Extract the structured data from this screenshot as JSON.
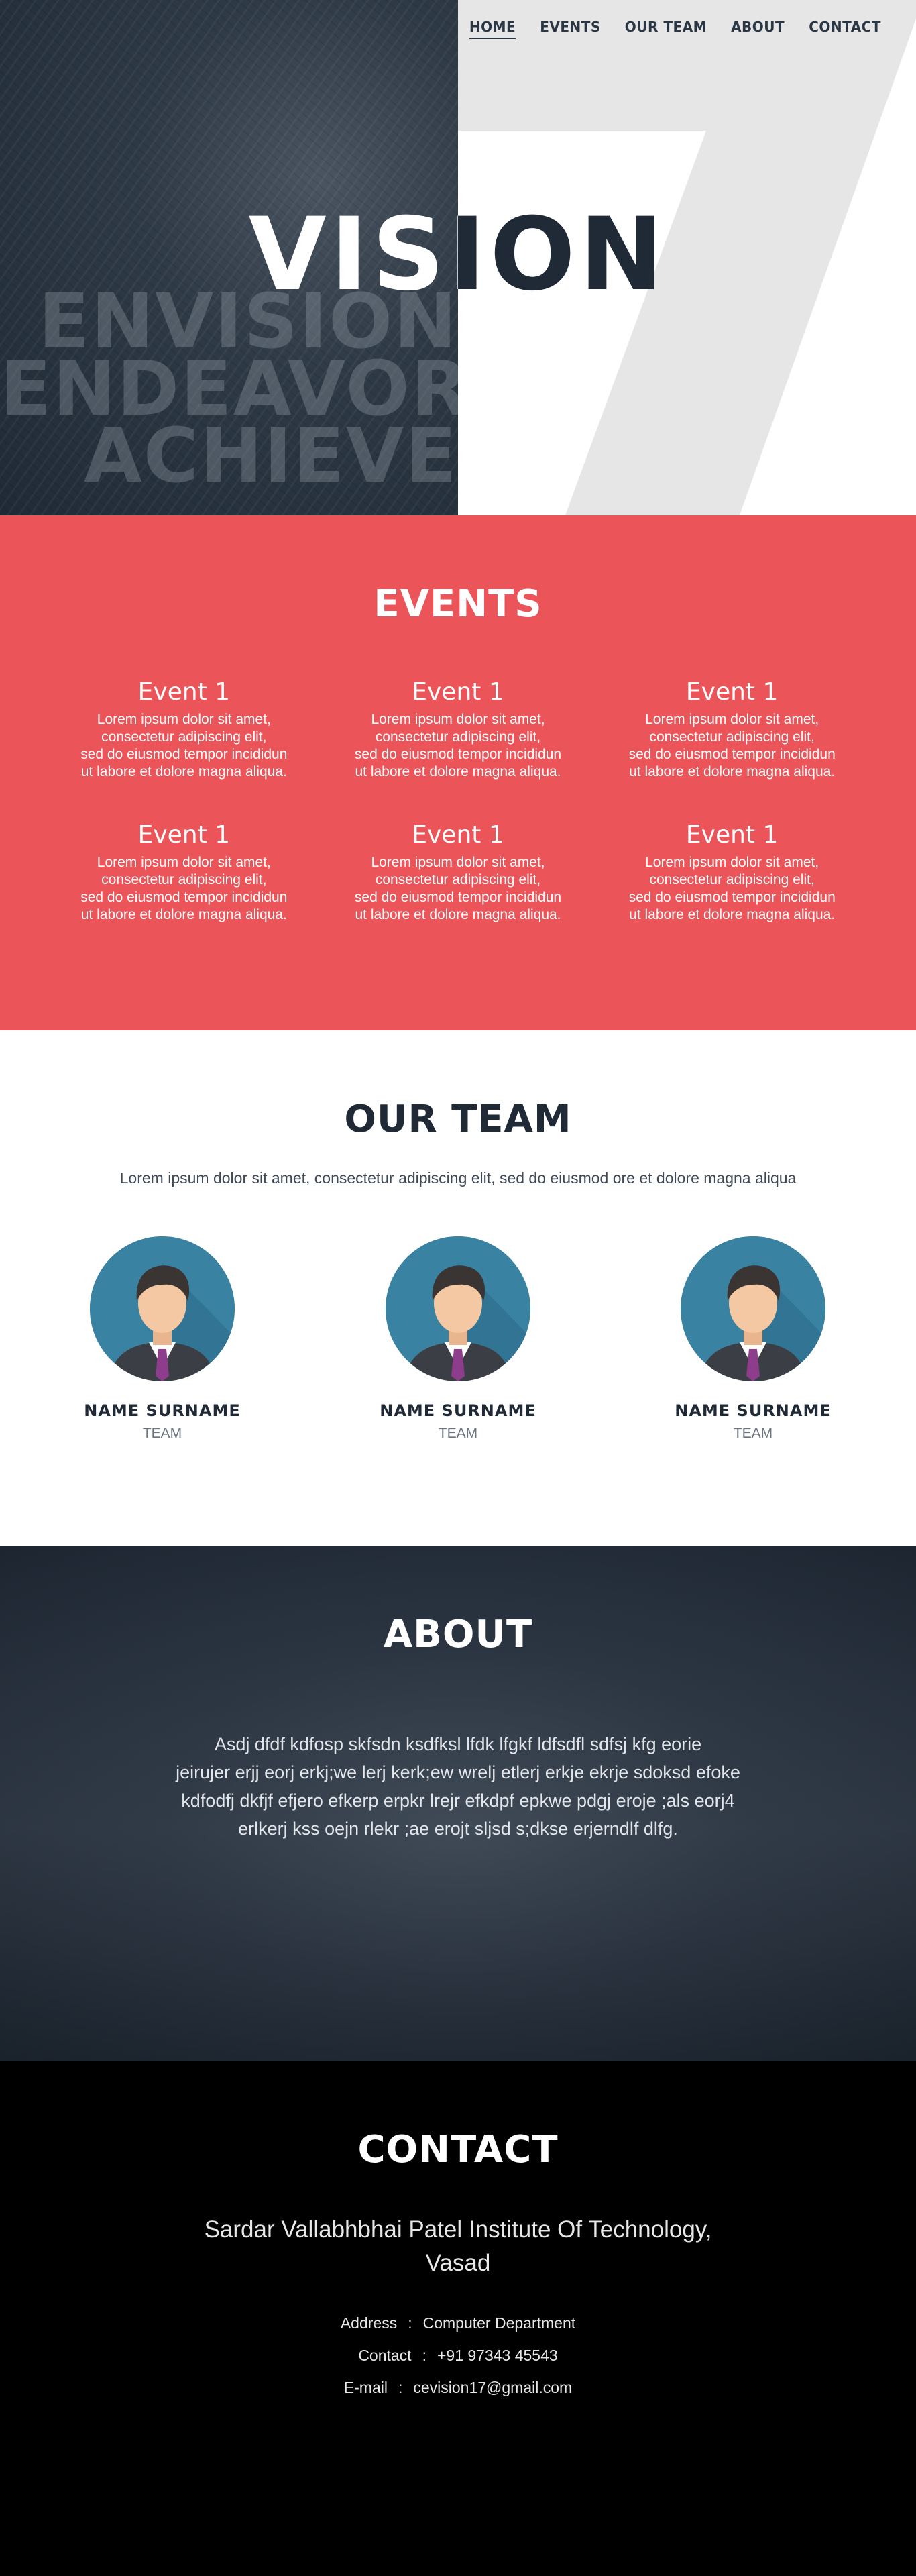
{
  "nav": {
    "items": [
      {
        "label": "HOME",
        "active": true
      },
      {
        "label": "EVENTS",
        "active": false
      },
      {
        "label": "OUR TEAM",
        "active": false
      },
      {
        "label": "ABOUT",
        "active": false
      },
      {
        "label": "CONTACT",
        "active": false
      }
    ]
  },
  "hero": {
    "title": "VISION",
    "words": [
      "ENVISION",
      "ENDEAVOR",
      "ACHIEVE"
    ],
    "big_numeral": "7"
  },
  "events": {
    "title": "EVENTS",
    "items": [
      {
        "title": "Event 1",
        "lines": [
          "Lorem ipsum dolor sit amet,",
          "consectetur adipiscing elit,",
          "sed do eiusmod tempor incididun",
          "ut labore et dolore magna aliqua."
        ]
      },
      {
        "title": "Event 1",
        "lines": [
          "Lorem ipsum dolor sit amet,",
          "consectetur adipiscing elit,",
          "sed do eiusmod tempor incididun",
          "ut labore et dolore magna aliqua."
        ]
      },
      {
        "title": "Event 1",
        "lines": [
          "Lorem ipsum dolor sit amet,",
          "consectetur adipiscing elit,",
          "sed do eiusmod tempor incididun",
          "ut labore et dolore magna aliqua."
        ]
      },
      {
        "title": "Event 1",
        "lines": [
          "Lorem ipsum dolor sit amet,",
          "consectetur adipiscing elit,",
          "sed do eiusmod tempor incididun",
          "ut labore et dolore magna aliqua."
        ]
      },
      {
        "title": "Event 1",
        "lines": [
          "Lorem ipsum dolor sit amet,",
          "consectetur adipiscing elit,",
          "sed do eiusmod tempor incididun",
          "ut labore et dolore magna aliqua."
        ]
      },
      {
        "title": "Event 1",
        "lines": [
          "Lorem ipsum dolor sit amet,",
          "consectetur adipiscing elit,",
          "sed do eiusmod tempor incididun",
          "ut labore et dolore magna aliqua."
        ]
      }
    ]
  },
  "team": {
    "title": "OUR TEAM",
    "intro": "Lorem ipsum dolor sit amet, consectetur adipiscing elit, sed do eiusmod ore et dolore magna aliqua",
    "members": [
      {
        "name": "NAME SURNAME",
        "role": "TEAM"
      },
      {
        "name": "NAME SURNAME",
        "role": "TEAM"
      },
      {
        "name": "NAME SURNAME",
        "role": "TEAM"
      }
    ]
  },
  "about": {
    "title": "ABOUT",
    "lines": [
      "Asdj dfdf kdfosp skfsdn ksdfksl lfdk lfgkf ldfsdfl sdfsj kfg eorie",
      "jeirujer erjj eorj erkj;we lerj kerk;ew wrelj etlerj erkje ekrje  sdoksd efoke",
      "kdfodfj dkfjf efjero efkerp erpkr lrejr efkdpf epkwe pdgj eroje ;als eorj4",
      "erlkerj kss oejn rlekr ;ae erojt sljsd s;dkse erjerndlf dlfg."
    ]
  },
  "contact": {
    "title": "CONTACT",
    "institute_lines": [
      "Sardar Vallabhbhai Patel Institute Of Technology,",
      "Vasad"
    ],
    "rows": [
      {
        "label": "Address",
        "sep": ":",
        "value": "Computer Department"
      },
      {
        "label": "Contact",
        "sep": ":",
        "value": "+91 97343 45543"
      },
      {
        "label": "E-mail",
        "sep": ":",
        "value": "cevision17@gmail.com"
      }
    ]
  },
  "colors": {
    "events_bg": "#eb5459",
    "dark_navy": "#1f2a36",
    "avatar_bg": "#3a82a2",
    "tie": "#8e3d8c"
  }
}
